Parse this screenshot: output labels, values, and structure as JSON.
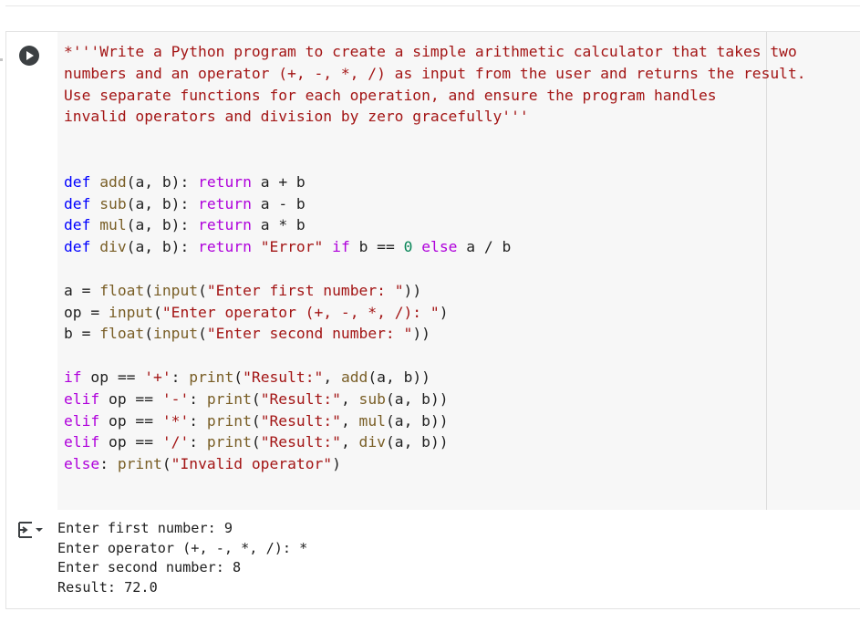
{
  "icons": {
    "run": "play-icon",
    "output": "output-collapse-icon"
  },
  "code_lines": [
    [
      {
        "t": "*'''Write a Python program to create a simple arithmetic calculator that takes two",
        "c": "s"
      }
    ],
    [
      {
        "t": "numbers and an operator (+, -, *, /) as input from the user and returns the result.",
        "c": "s"
      }
    ],
    [
      {
        "t": "Use separate functions for each operation, and ensure the program handles",
        "c": "s"
      }
    ],
    [
      {
        "t": "invalid operators and division by zero gracefully'''",
        "c": "s"
      }
    ],
    [],
    [],
    [
      {
        "t": "def",
        "c": "k"
      },
      {
        "t": " "
      },
      {
        "t": "add",
        "c": "c"
      },
      {
        "t": "(a, b): "
      },
      {
        "t": "return",
        "c": "p"
      },
      {
        "t": " a + b"
      }
    ],
    [
      {
        "t": "def",
        "c": "k"
      },
      {
        "t": " "
      },
      {
        "t": "sub",
        "c": "c"
      },
      {
        "t": "(a, b): "
      },
      {
        "t": "return",
        "c": "p"
      },
      {
        "t": " a - b"
      }
    ],
    [
      {
        "t": "def",
        "c": "k"
      },
      {
        "t": " "
      },
      {
        "t": "mul",
        "c": "c"
      },
      {
        "t": "(a, b): "
      },
      {
        "t": "return",
        "c": "p"
      },
      {
        "t": " a * b"
      }
    ],
    [
      {
        "t": "def",
        "c": "k"
      },
      {
        "t": " "
      },
      {
        "t": "div",
        "c": "c"
      },
      {
        "t": "(a, b): "
      },
      {
        "t": "return",
        "c": "p"
      },
      {
        "t": " "
      },
      {
        "t": "\"Error\"",
        "c": "s"
      },
      {
        "t": " "
      },
      {
        "t": "if",
        "c": "p"
      },
      {
        "t": " b == "
      },
      {
        "t": "0",
        "c": "n"
      },
      {
        "t": " "
      },
      {
        "t": "else",
        "c": "p"
      },
      {
        "t": " a / b"
      }
    ],
    [],
    [
      {
        "t": "a = "
      },
      {
        "t": "float",
        "c": "c"
      },
      {
        "t": "("
      },
      {
        "t": "input",
        "c": "c"
      },
      {
        "t": "("
      },
      {
        "t": "\"Enter first number: \"",
        "c": "s"
      },
      {
        "t": "))"
      }
    ],
    [
      {
        "t": "op = "
      },
      {
        "t": "input",
        "c": "c"
      },
      {
        "t": "("
      },
      {
        "t": "\"Enter operator (+, -, *, /): \"",
        "c": "s"
      },
      {
        "t": ")"
      }
    ],
    [
      {
        "t": "b = "
      },
      {
        "t": "float",
        "c": "c"
      },
      {
        "t": "("
      },
      {
        "t": "input",
        "c": "c"
      },
      {
        "t": "("
      },
      {
        "t": "\"Enter second number: \"",
        "c": "s"
      },
      {
        "t": "))"
      }
    ],
    [],
    [
      {
        "t": "if",
        "c": "p"
      },
      {
        "t": " op == "
      },
      {
        "t": "'+'",
        "c": "s"
      },
      {
        "t": ": "
      },
      {
        "t": "print",
        "c": "c"
      },
      {
        "t": "("
      },
      {
        "t": "\"Result:\"",
        "c": "s"
      },
      {
        "t": ", "
      },
      {
        "t": "add",
        "c": "c"
      },
      {
        "t": "(a, b))"
      }
    ],
    [
      {
        "t": "elif",
        "c": "p"
      },
      {
        "t": " op == "
      },
      {
        "t": "'-'",
        "c": "s"
      },
      {
        "t": ": "
      },
      {
        "t": "print",
        "c": "c"
      },
      {
        "t": "("
      },
      {
        "t": "\"Result:\"",
        "c": "s"
      },
      {
        "t": ", "
      },
      {
        "t": "sub",
        "c": "c"
      },
      {
        "t": "(a, b))"
      }
    ],
    [
      {
        "t": "elif",
        "c": "p"
      },
      {
        "t": " op == "
      },
      {
        "t": "'*'",
        "c": "s"
      },
      {
        "t": ": "
      },
      {
        "t": "print",
        "c": "c"
      },
      {
        "t": "("
      },
      {
        "t": "\"Result:\"",
        "c": "s"
      },
      {
        "t": ", "
      },
      {
        "t": "mul",
        "c": "c"
      },
      {
        "t": "(a, b))"
      }
    ],
    [
      {
        "t": "elif",
        "c": "p"
      },
      {
        "t": " op == "
      },
      {
        "t": "'/'",
        "c": "s"
      },
      {
        "t": ": "
      },
      {
        "t": "print",
        "c": "c"
      },
      {
        "t": "("
      },
      {
        "t": "\"Result:\"",
        "c": "s"
      },
      {
        "t": ", "
      },
      {
        "t": "div",
        "c": "c"
      },
      {
        "t": "(a, b))"
      }
    ],
    [
      {
        "t": "else",
        "c": "p"
      },
      {
        "t": ": "
      },
      {
        "t": "print",
        "c": "c"
      },
      {
        "t": "("
      },
      {
        "t": "\"Invalid operator\"",
        "c": "s"
      },
      {
        "t": ")"
      }
    ]
  ],
  "output_lines": [
    "Enter first number: 9",
    "Enter operator (+, -, *, /): *",
    "Enter second number: 8",
    "Result: 72.0"
  ]
}
